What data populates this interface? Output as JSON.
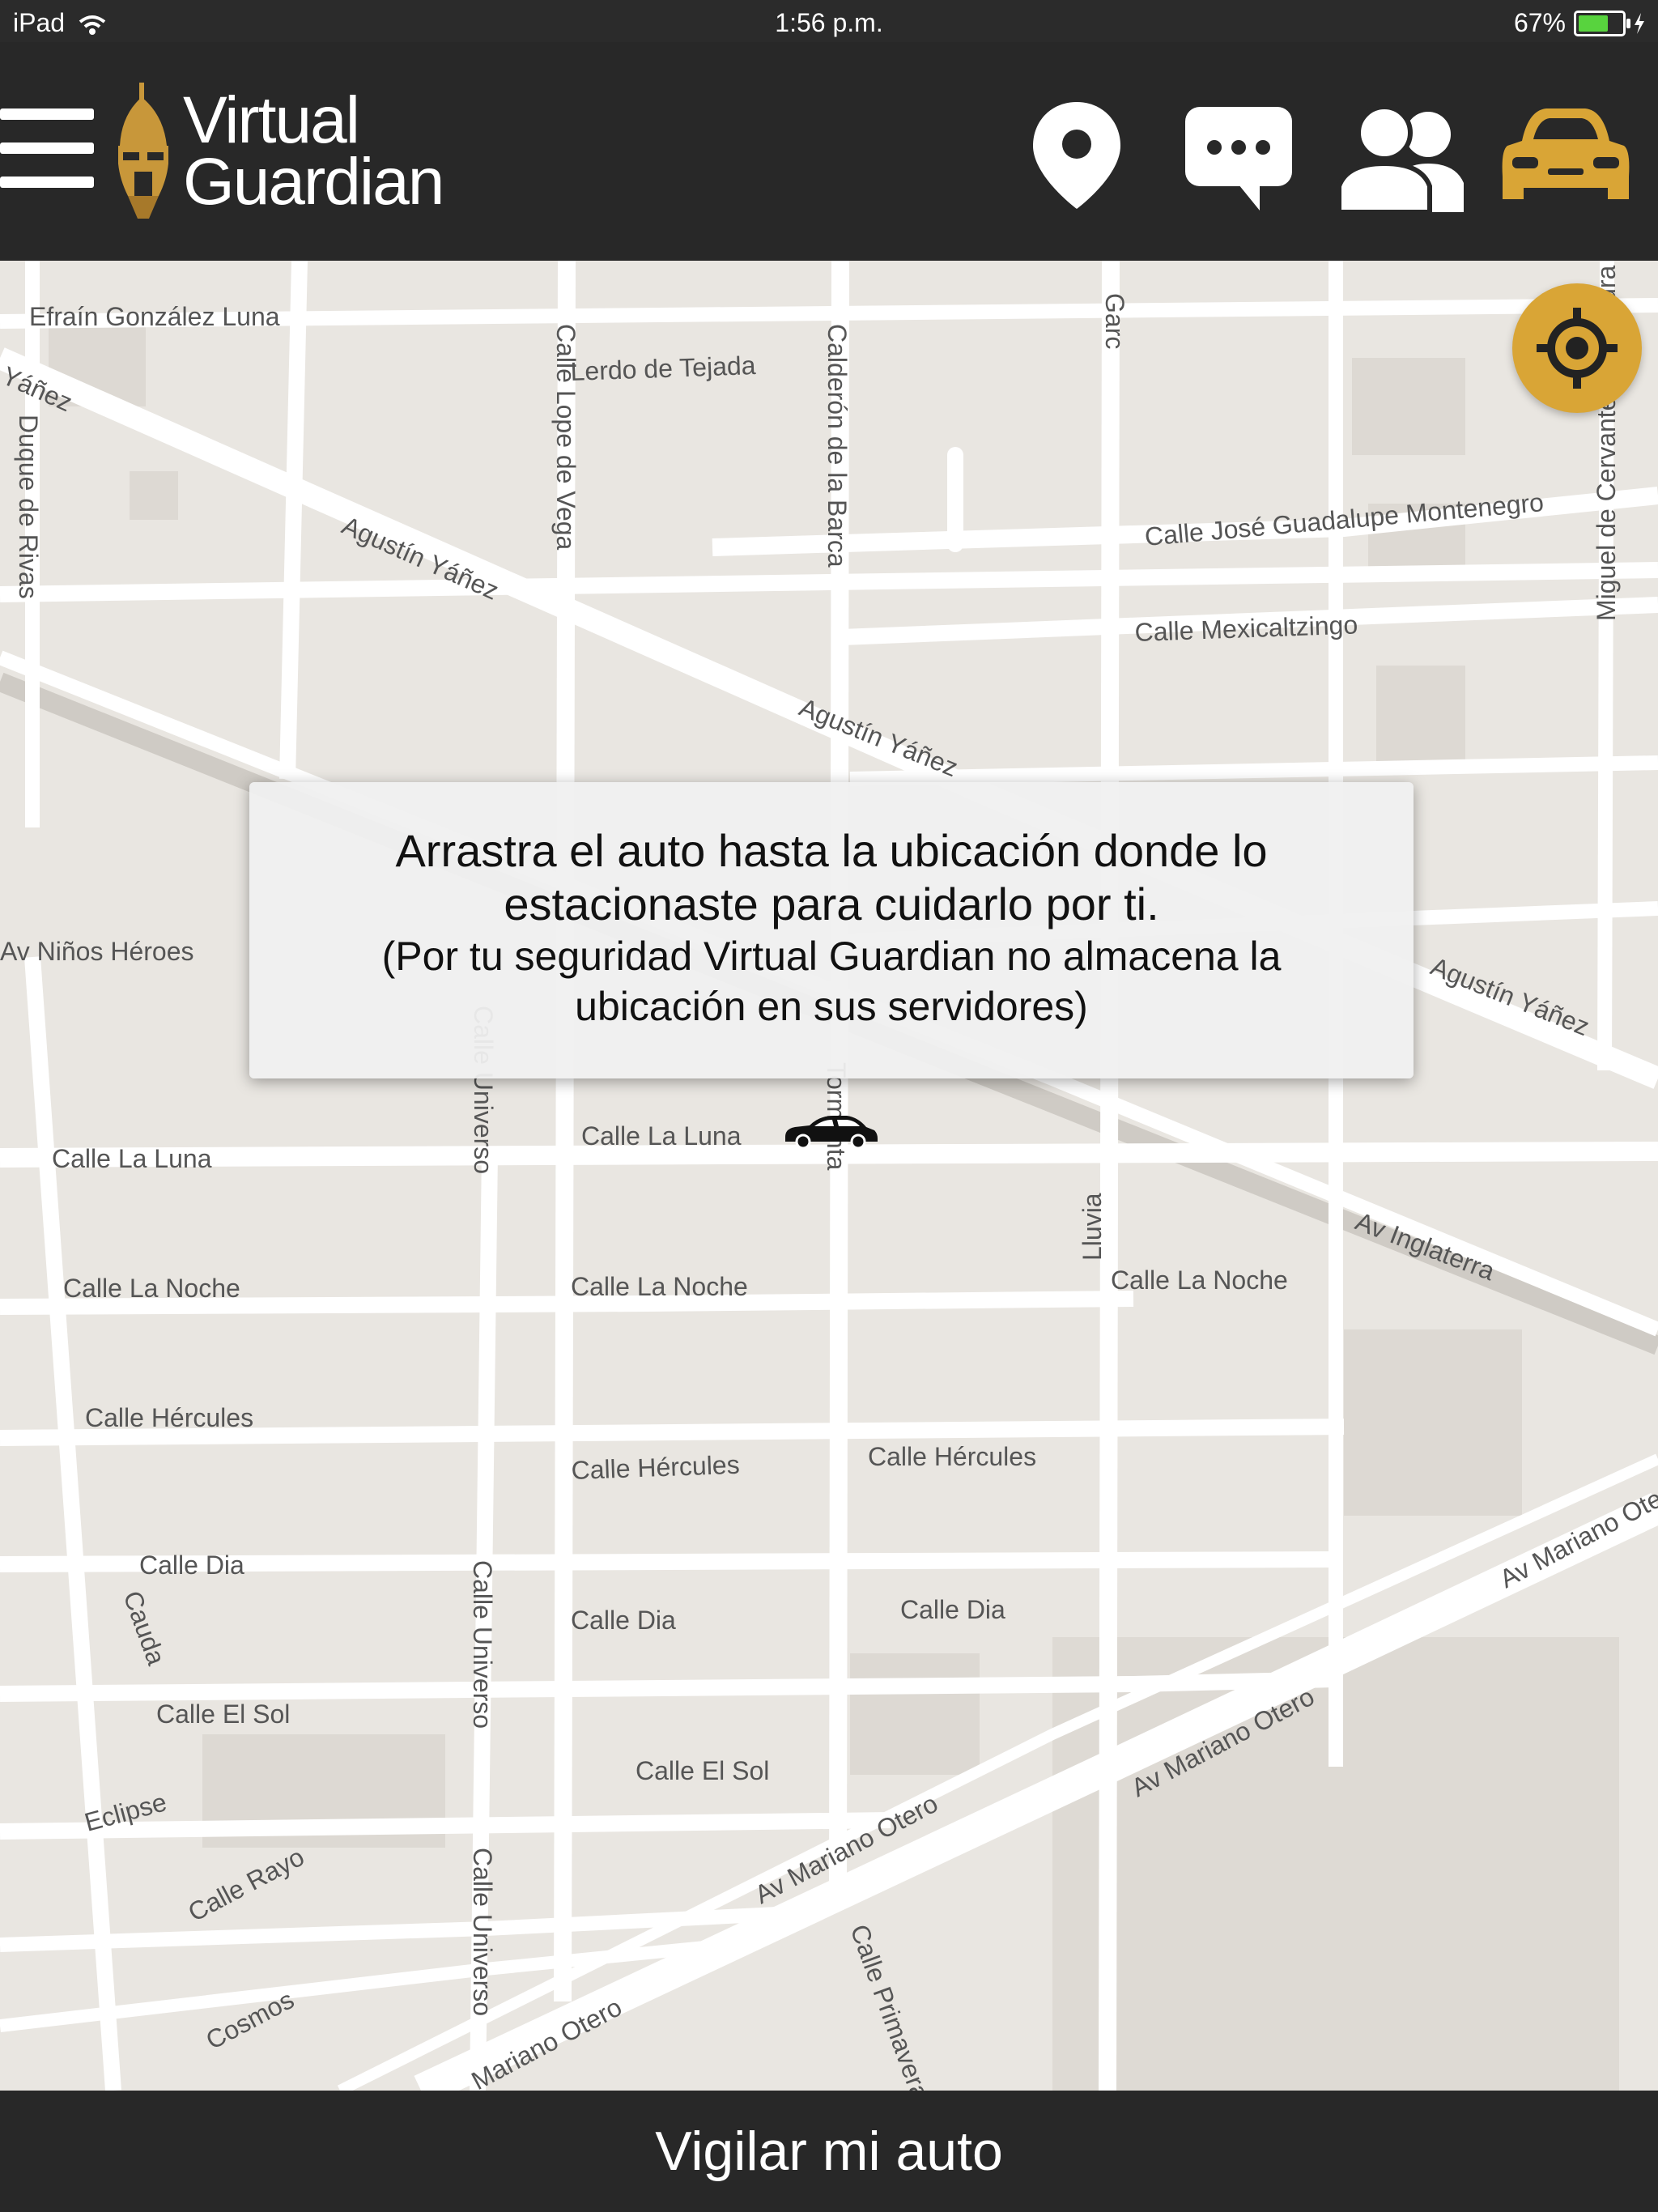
{
  "status_bar": {
    "device": "iPad",
    "time": "1:56 p.m.",
    "battery": "67%",
    "battery_level": 0.67
  },
  "header": {
    "logo_line1": "Virtual",
    "logo_line2": "Guardian",
    "icons": [
      "location-pin-icon",
      "chat-bubble-icon",
      "contacts-icon",
      "car-icon"
    ],
    "active_color": "#d9a536"
  },
  "map": {
    "streets": [
      "Lerdo de Tejada",
      "Efraín González Luna",
      "Yáñez",
      "Duque de Rivas",
      "Agustín Yáñez",
      "Calle Lope de Vega",
      "Calderón de la Barca",
      "Calle José Guadalupe Montenegro",
      "Calle Mexicaltzingo",
      "Agustín Yáñez",
      "Miguel de Cervantes Saavedra",
      "Av Niños Héroes",
      "Agustín Yáñez",
      "Calle La Luna",
      "Calle La Luna",
      "Calle Universo",
      "Tormenta",
      "Lluvia",
      "Av Inglaterra",
      "Calle La Noche",
      "Calle La Noche",
      "Calle La Noche",
      "Calle Hércules",
      "Calle Hércules",
      "Calle Hércules",
      "Calle Dia",
      "Calle Dia",
      "Calle Dia",
      "Cauda",
      "Calle El Sol",
      "Calle El Sol",
      "Calle Universo",
      "Eclipse",
      "Calle Rayo",
      "Av Mariano Otero",
      "Av Mariano Otero",
      "Av Mariano Otero",
      "Calle Universo",
      "Cosmos",
      "Calle Primavera",
      "Mariano Otero",
      "Garc"
    ]
  },
  "dialog": {
    "line1": "Arrastra el auto hasta la ubicación donde lo estacionaste para cuidarlo por ti.",
    "line2": "(Por tu seguridad Virtual Guardian no almacena la ubicación en sus servidores)"
  },
  "bottom_button": {
    "label": "Vigilar mi auto"
  }
}
